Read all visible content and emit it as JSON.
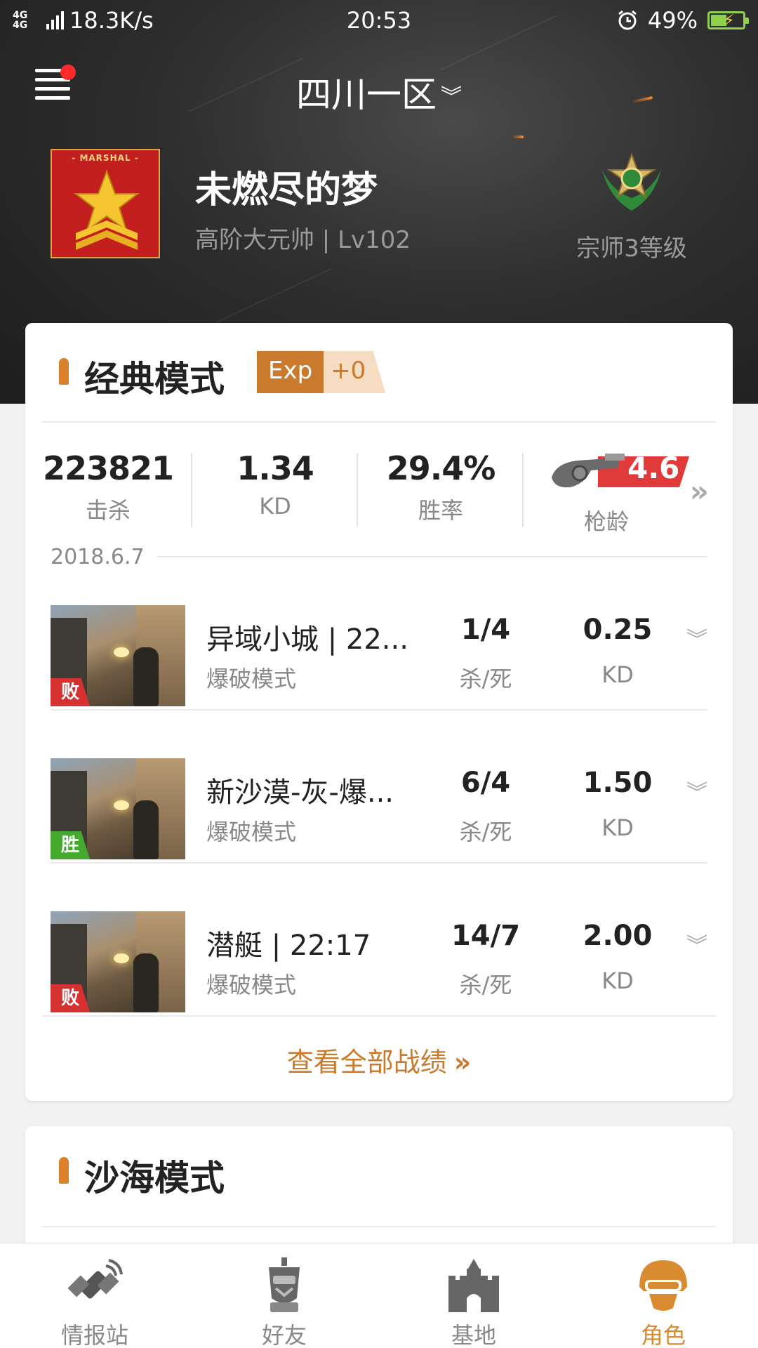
{
  "status_bar": {
    "network": "4G 4G",
    "speed": "18.3K/s",
    "time": "20:53",
    "battery": "49%"
  },
  "header": {
    "region": "四川一区",
    "rank_badge_text": "- MARSHAL -",
    "player_name": "未燃尽的梦",
    "player_rank": "高阶大元帅 | Lv102",
    "grade_label": "宗师3等级"
  },
  "classic": {
    "title": "经典模式",
    "exp_label": "Exp",
    "exp_value": "+0",
    "stats": [
      {
        "value": "223821",
        "label": "击杀"
      },
      {
        "value": "1.34",
        "label": "KD"
      },
      {
        "value": "29.4%",
        "label": "胜率"
      }
    ],
    "gun_age_value": "4.6",
    "gun_age_label": "枪龄",
    "more": "»",
    "date": "2018.6.7",
    "matches": [
      {
        "name": "异域小城 | 22...",
        "mode": "爆破模式",
        "kd": "1/4",
        "kd_label": "杀/死",
        "ratio": "0.25",
        "ratio_label": "KD",
        "result": "败",
        "result_type": "lose"
      },
      {
        "name": "新沙漠-灰-爆...",
        "mode": "爆破模式",
        "kd": "6/4",
        "kd_label": "杀/死",
        "ratio": "1.50",
        "ratio_label": "KD",
        "result": "胜",
        "result_type": "win"
      },
      {
        "name": "潜艇 | 22:17",
        "mode": "爆破模式",
        "kd": "14/7",
        "kd_label": "杀/死",
        "ratio": "2.00",
        "ratio_label": "KD",
        "result": "败",
        "result_type": "lose"
      }
    ],
    "view_all": "查看全部战绩",
    "view_all_arrow": "»"
  },
  "desert": {
    "title": "沙海模式"
  },
  "nav": [
    {
      "label": "情报站",
      "icon": "satellite-icon",
      "active": false
    },
    {
      "label": "好友",
      "icon": "robot-friend-icon",
      "active": false
    },
    {
      "label": "基地",
      "icon": "castle-icon",
      "active": false
    },
    {
      "label": "角色",
      "icon": "helmet-icon",
      "active": true
    }
  ],
  "colors": {
    "accent": "#c97a2c",
    "lose": "#d63131",
    "win": "#45a82f",
    "nav_active": "#d98c2f"
  }
}
